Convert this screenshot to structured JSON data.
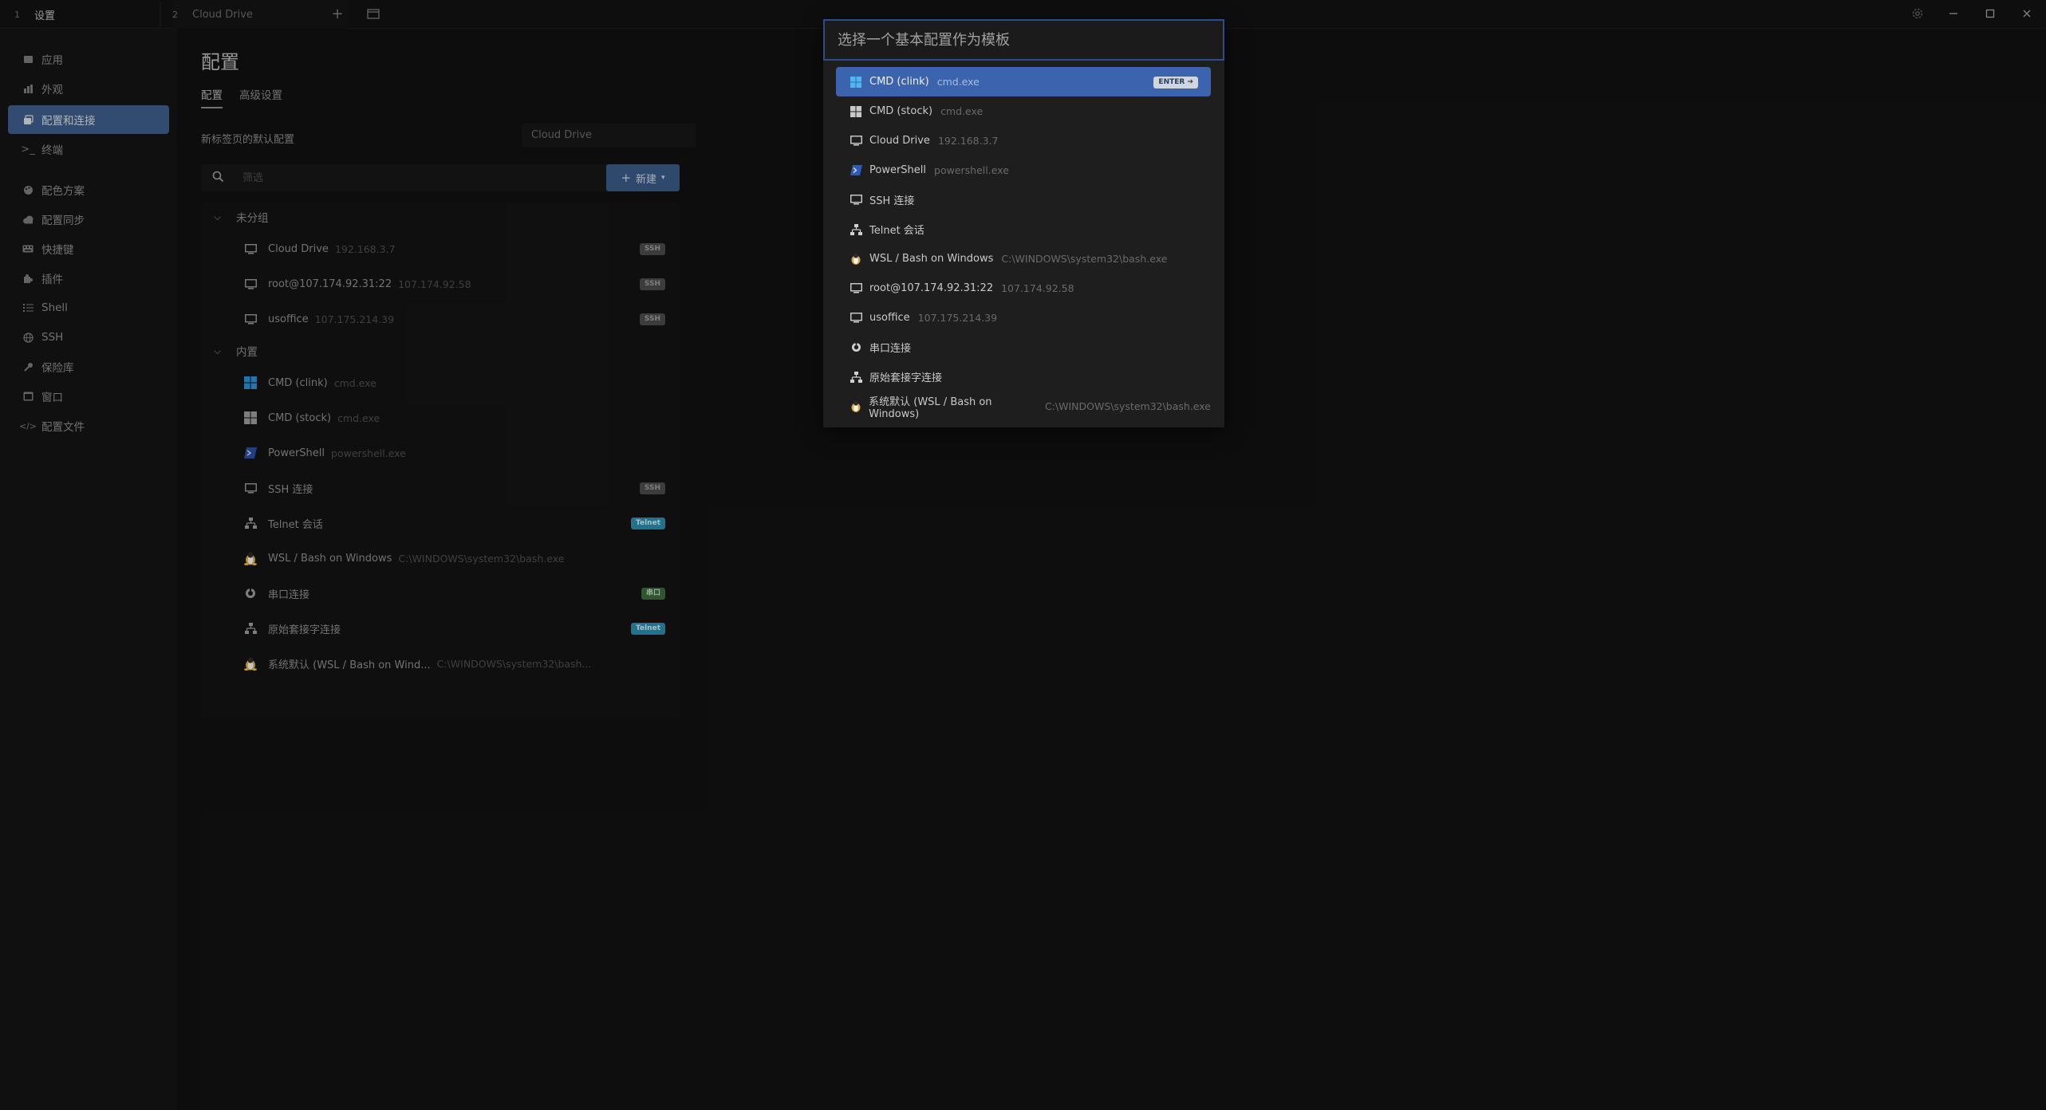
{
  "titlebar": {
    "tabs": [
      {
        "index": "1",
        "label": "设置"
      },
      {
        "index": "2",
        "label": "Cloud Drive"
      }
    ],
    "new_tab_icon": "plus-icon",
    "window_controls": [
      "settings-gear-icon",
      "minimize-icon",
      "maximize-icon",
      "close-icon"
    ]
  },
  "sidebar": {
    "items": [
      {
        "label": "应用",
        "icon": "application-icon"
      },
      {
        "label": "外观",
        "icon": "appearance-icon"
      },
      {
        "label": "配置和连接",
        "icon": "profiles-icon",
        "active": true
      },
      {
        "label": "终端",
        "icon": "terminal-icon"
      },
      {
        "label": "配色方案",
        "icon": "palette-icon"
      },
      {
        "label": "配置同步",
        "icon": "cloud-icon"
      },
      {
        "label": "快捷键",
        "icon": "keyboard-icon"
      },
      {
        "label": "插件",
        "icon": "puzzle-icon"
      },
      {
        "label": "Shell",
        "icon": "list-icon"
      },
      {
        "label": "SSH",
        "icon": "globe-icon"
      },
      {
        "label": "保险库",
        "icon": "key-icon"
      },
      {
        "label": "窗口",
        "icon": "window-icon"
      },
      {
        "label": "配置文件",
        "icon": "code-icon"
      }
    ]
  },
  "main": {
    "title": "配置",
    "subtabs": [
      "配置",
      "高级设置"
    ],
    "default_profile_label": "新标签页的默认配置",
    "default_profile_value": "Cloud Drive",
    "filter_placeholder": "筛选",
    "new_button_label": "新建",
    "groups": [
      {
        "name": "未分组",
        "profiles": [
          {
            "name": "Cloud Drive",
            "desc": "192.168.3.7",
            "icon": "monitor-icon",
            "badge": "SSH",
            "badge_type": "ssh"
          },
          {
            "name": "root@107.174.92.31:22",
            "desc": "107.174.92.58",
            "icon": "monitor-icon",
            "badge": "SSH",
            "badge_type": "ssh"
          },
          {
            "name": "usoffice",
            "desc": "107.175.214.39",
            "icon": "monitor-icon",
            "badge": "SSH",
            "badge_type": "ssh"
          }
        ]
      },
      {
        "name": "内置",
        "profiles": [
          {
            "name": "CMD (clink)",
            "desc": "cmd.exe",
            "icon": "windows-icon-blue",
            "badge": "",
            "badge_type": ""
          },
          {
            "name": "CMD (stock)",
            "desc": "cmd.exe",
            "icon": "windows-icon-gray",
            "badge": "",
            "badge_type": ""
          },
          {
            "name": "PowerShell",
            "desc": "powershell.exe",
            "icon": "powershell-icon",
            "badge": "",
            "badge_type": ""
          },
          {
            "name": "SSH 连接",
            "desc": "",
            "icon": "monitor-icon",
            "badge": "SSH",
            "badge_type": "ssh"
          },
          {
            "name": "Telnet 会话",
            "desc": "",
            "icon": "network-icon",
            "badge": "Telnet",
            "badge_type": "telnet"
          },
          {
            "name": "WSL / Bash on Windows",
            "desc": "C:\\WINDOWS\\system32\\bash.exe",
            "icon": "linux-icon",
            "badge": "",
            "badge_type": ""
          },
          {
            "name": "串口连接",
            "desc": "",
            "icon": "serial-icon",
            "badge": "串口",
            "badge_type": "serial"
          },
          {
            "name": "原始套接字连接",
            "desc": "",
            "icon": "network-icon",
            "badge": "Telnet",
            "badge_type": "telnet"
          },
          {
            "name": "系统默认 (WSL / Bash on Wind...",
            "desc": "C:\\WINDOWS\\system32\\bash...",
            "icon": "linux-icon",
            "badge": "",
            "badge_type": ""
          }
        ]
      }
    ]
  },
  "modal": {
    "placeholder": "选择一个基本配置作为模板",
    "enter_hint": "ENTER ➔",
    "items": [
      {
        "name": "CMD (clink)",
        "desc": "cmd.exe",
        "icon": "windows-icon-blue",
        "selected": true
      },
      {
        "name": "CMD (stock)",
        "desc": "cmd.exe",
        "icon": "windows-icon-gray"
      },
      {
        "name": "Cloud Drive",
        "desc": "192.168.3.7",
        "icon": "monitor-icon"
      },
      {
        "name": "PowerShell",
        "desc": "powershell.exe",
        "icon": "powershell-icon"
      },
      {
        "name": "SSH 连接",
        "desc": "",
        "icon": "monitor-icon"
      },
      {
        "name": "Telnet 会话",
        "desc": "",
        "icon": "network-icon"
      },
      {
        "name": "WSL / Bash on Windows",
        "desc": "C:\\WINDOWS\\system32\\bash.exe",
        "icon": "linux-icon"
      },
      {
        "name": "root@107.174.92.31:22",
        "desc": "107.174.92.58",
        "icon": "monitor-icon"
      },
      {
        "name": "usoffice",
        "desc": "107.175.214.39",
        "icon": "monitor-icon"
      },
      {
        "name": "串口连接",
        "desc": "",
        "icon": "serial-icon"
      },
      {
        "name": "原始套接字连接",
        "desc": "",
        "icon": "network-icon"
      },
      {
        "name": "系统默认 (WSL / Bash on Windows)",
        "desc": "C:\\WINDOWS\\system32\\bash.exe",
        "icon": "linux-icon"
      }
    ]
  },
  "colors": {
    "accent": "#3c63ad",
    "sidebar_active": "#3e5d8a",
    "badge_telnet": "#2a8caa",
    "badge_serial": "#3a6a3a",
    "badge_ssh": "#4a4a4a"
  }
}
